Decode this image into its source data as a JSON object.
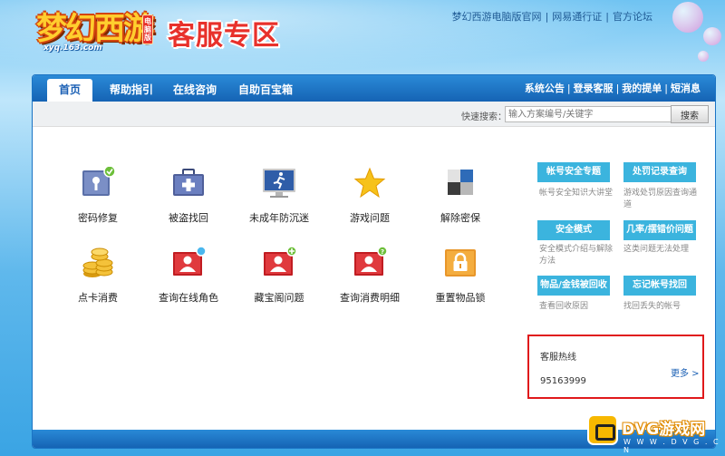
{
  "header": {
    "logo_game": "梦幻西游",
    "logo_tag": "电脑版",
    "logo_url": "xyq.163.com",
    "title": "客服专区",
    "top_links": [
      "梦幻西游电脑版官网",
      "网易通行证",
      "官方论坛"
    ]
  },
  "nav": {
    "tabs": [
      {
        "label": "首页",
        "active": true
      },
      {
        "label": "帮助指引",
        "active": false
      },
      {
        "label": "在线咨询",
        "active": false
      },
      {
        "label": "自助百宝箱",
        "active": false
      }
    ],
    "right_links": [
      "系统公告",
      "登录客服",
      "我的提单",
      "短消息"
    ]
  },
  "search": {
    "label": "快速搜索：",
    "placeholder": "输入方案编号/关键字",
    "button": "搜索"
  },
  "services": [
    {
      "label": "密码修复",
      "icon": "password-key-icon"
    },
    {
      "label": "被盗找回",
      "icon": "medical-kit-icon"
    },
    {
      "label": "未成年防沉迷",
      "icon": "monitor-runner-icon"
    },
    {
      "label": "游戏问题",
      "icon": "star-icon"
    },
    {
      "label": "解除密保",
      "icon": "blocks-icon"
    },
    {
      "label": "点卡消费",
      "icon": "coins-icon"
    },
    {
      "label": "查询在线角色",
      "icon": "user-search-icon"
    },
    {
      "label": "藏宝阁问题",
      "icon": "user-plus-icon"
    },
    {
      "label": "查询消费明细",
      "icon": "user-question-icon"
    },
    {
      "label": "重置物品锁",
      "icon": "lock-icon"
    }
  ],
  "sidebar": {
    "items": [
      {
        "button": "帐号安全专题",
        "desc": "帐号安全知识大讲堂"
      },
      {
        "button": "处罚记录查询",
        "desc": "游戏处罚原因查询通道"
      },
      {
        "button": "安全模式",
        "desc": "安全模式介绍与解除方法"
      },
      {
        "button": "几率/摆错价问题",
        "desc": "这类问题无法处理"
      },
      {
        "button": "物品/金钱被回收",
        "desc": "查看回收原因"
      },
      {
        "button": "忘记帐号找回",
        "desc": "找回丢失的帐号"
      }
    ],
    "hotline": {
      "title": "客服热线",
      "more": "更多 >",
      "number": "95163999"
    }
  },
  "watermark": {
    "text": "DVG游戏网",
    "url": "W W W . D V G . C N"
  },
  "colors": {
    "nav_blue": "#1a6fc4",
    "side_button": "#3bb4de",
    "hotline_border": "#e0191b",
    "title_red": "#e8312b"
  }
}
